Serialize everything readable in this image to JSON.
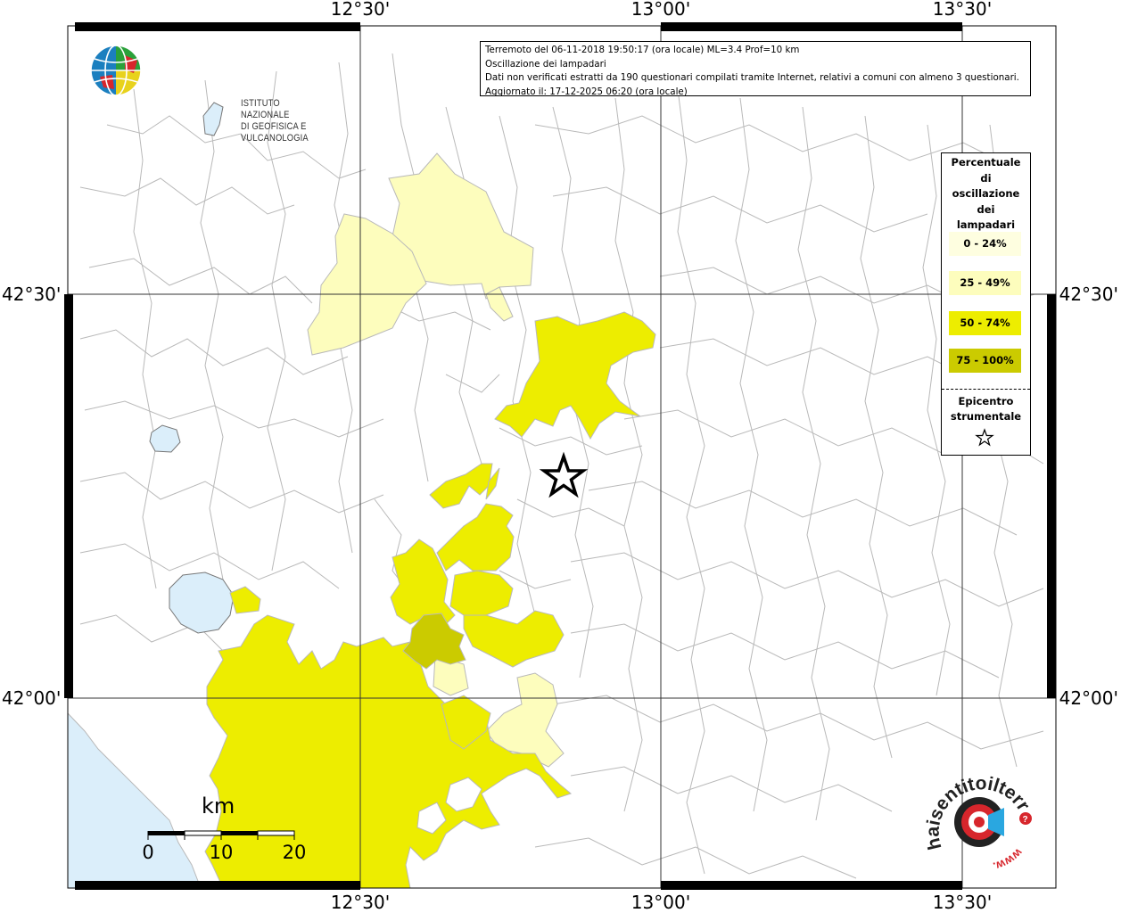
{
  "coord_labels": {
    "top": [
      "12°30'",
      "13°00'",
      "13°30'"
    ],
    "bottom": [
      "12°30'",
      "13°00'",
      "13°30'"
    ],
    "left": [
      "42°30'",
      "42°00'"
    ],
    "right": [
      "42°30'",
      "42°00'"
    ]
  },
  "info": {
    "line1": "Terremoto del 06-11-2018 19:50:17 (ora locale) ML=3.4 Prof=10 km",
    "line2": "Oscillazione dei lampadari",
    "line3": "Dati non verificati estratti da 190 questionari compilati tramite Internet, relativi a comuni con almeno 3 questionari.",
    "line4": "Aggiornato il: 17-12-2025 06:20 (ora locale)"
  },
  "logo": {
    "line1": "ISTITUTO NAZIONALE",
    "line2": "DI GEOFISICA E VULCANOLOGIA"
  },
  "legend": {
    "title_lines": [
      "Percentuale",
      "di",
      "oscillazione",
      "dei",
      "lampadari"
    ],
    "classes": [
      {
        "label": "0 - 24%",
        "color": "#fefee0"
      },
      {
        "label": "25 - 49%",
        "color": "#fdfdbd"
      },
      {
        "label": "50 - 74%",
        "color": "#eded00"
      },
      {
        "label": "75 - 100%",
        "color": "#cbcb00"
      }
    ],
    "epicenter_lines": [
      "Epicentro",
      "strumentale"
    ]
  },
  "scale": {
    "unit": "km",
    "ticks": [
      "0",
      "10",
      "20"
    ]
  },
  "haisentito": {
    "text": "haisentitoilterremoto.it",
    "www": "www."
  },
  "colors": {
    "sea": "#dbeefa",
    "border": "#b4b4b4",
    "grid": "#333333"
  }
}
